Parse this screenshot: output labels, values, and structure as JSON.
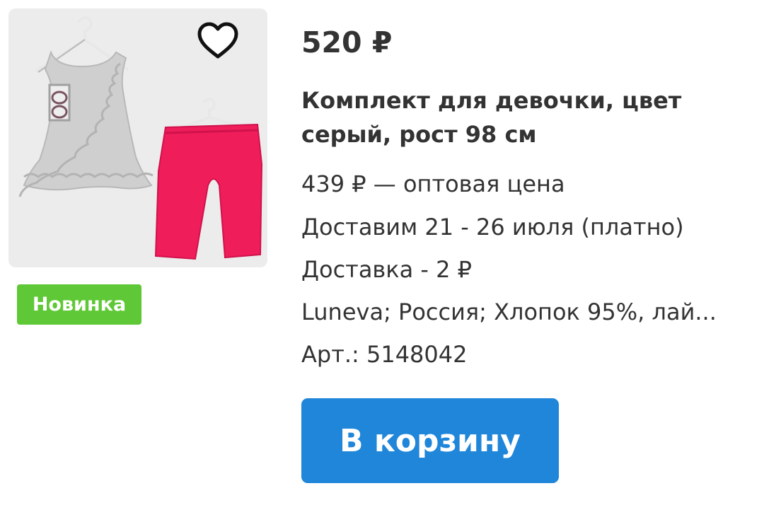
{
  "product": {
    "price": "520 ₽",
    "title": "Комплект для девочки, цвет серый, рост 98 см",
    "wholesale_price": "439 ₽ — оптовая цена",
    "delivery_dates": "Доставим 21 - 26 июля (платно)",
    "delivery_cost": "Доставка - 2 ₽",
    "attributes": "Luneva; Россия; Хлопок 95%, лай...",
    "article": "Арт.: 5148042"
  },
  "badge": {
    "label": "Новинка",
    "color": "#5fc836"
  },
  "actions": {
    "add_to_cart_label": "В корзину",
    "button_color": "#1f86d9"
  },
  "favorite": {
    "icon": "heart-outline-icon",
    "active": false
  },
  "image": {
    "description_colors": {
      "top": "#c8c8c8",
      "leggings": "#ef1d5a"
    }
  }
}
